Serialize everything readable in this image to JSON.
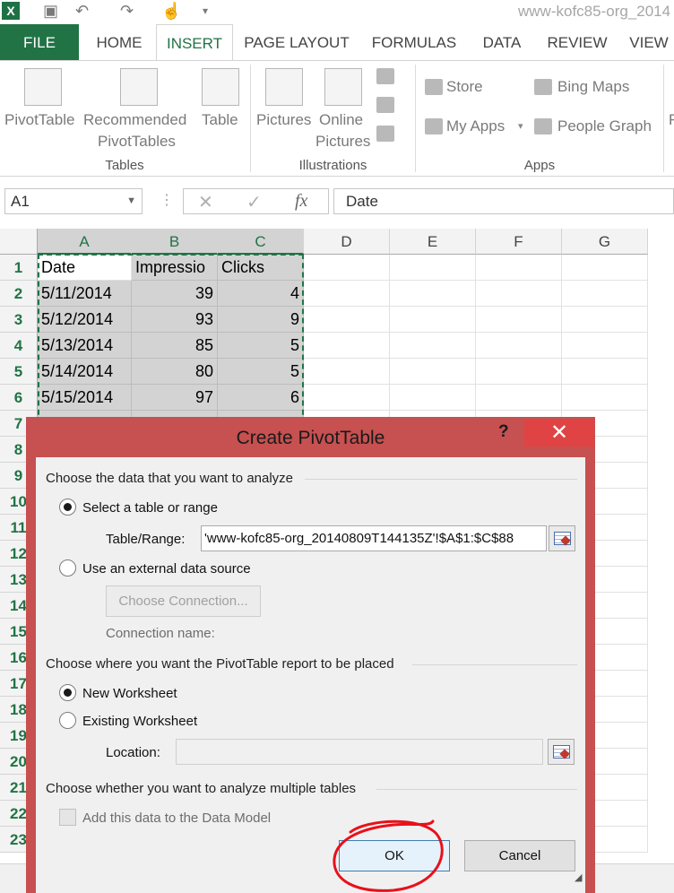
{
  "titlebar": {
    "doc_title": "www-kofc85-org_2014"
  },
  "tabs": [
    {
      "label": "FILE"
    },
    {
      "label": "HOME"
    },
    {
      "label": "INSERT"
    },
    {
      "label": "PAGE LAYOUT"
    },
    {
      "label": "FORMULAS"
    },
    {
      "label": "DATA"
    },
    {
      "label": "REVIEW"
    },
    {
      "label": "VIEW"
    }
  ],
  "ribbon": {
    "tables": {
      "group": "Tables",
      "pivottable": "PivotTable",
      "recommended_1": "Recommended",
      "recommended_2": "PivotTables",
      "table": "Table"
    },
    "illustrations": {
      "group": "Illustrations",
      "pictures": "Pictures",
      "online_1": "Online",
      "online_2": "Pictures"
    },
    "apps": {
      "group": "Apps",
      "store": "Store",
      "my_apps": "My Apps",
      "bing_maps": "Bing Maps",
      "people_graph": "People Graph"
    },
    "cut_letter": "F"
  },
  "formula_bar": {
    "name_box": "A1",
    "fx": "fx",
    "content": "Date"
  },
  "grid": {
    "columns": [
      "A",
      "B",
      "C",
      "D",
      "E",
      "F",
      "G"
    ],
    "rows": [
      "1",
      "2",
      "3",
      "4",
      "5",
      "6",
      "7",
      "8",
      "9",
      "10",
      "11",
      "12",
      "13",
      "14",
      "15",
      "16",
      "17",
      "18",
      "19",
      "20",
      "21",
      "22",
      "23"
    ],
    "cells": [
      [
        "Date",
        "Impressio",
        "Clicks"
      ],
      [
        "5/11/2014",
        "39",
        "4"
      ],
      [
        "5/12/2014",
        "93",
        "9"
      ],
      [
        "5/13/2014",
        "85",
        "5"
      ],
      [
        "5/14/2014",
        "80",
        "5"
      ],
      [
        "5/15/2014",
        "97",
        "6"
      ]
    ]
  },
  "dialog": {
    "title": "Create PivotTable",
    "help": "?",
    "close": "✕",
    "section1": "Choose the data that you want to analyze",
    "opt_select_table": "Select a table or range",
    "table_range_label": "Table/Range:",
    "table_range_value": "'www-kofc85-org_20140809T144135Z'!$A$1:$C$88",
    "opt_external": "Use an external data source",
    "choose_connection": "Choose Connection...",
    "connection_name": "Connection name:",
    "section2": "Choose where you want the PivotTable report to be placed",
    "opt_new_ws": "New Worksheet",
    "opt_existing_ws": "Existing Worksheet",
    "location_label": "Location:",
    "location_value": "",
    "section3": "Choose whether you want to analyze multiple tables",
    "add_data_model": "Add this data to the Data Model",
    "ok": "OK",
    "cancel": "Cancel"
  },
  "colors": {
    "excel_green": "#217346",
    "dialog_frame": "#c75050",
    "annotation": "#e8101a"
  }
}
